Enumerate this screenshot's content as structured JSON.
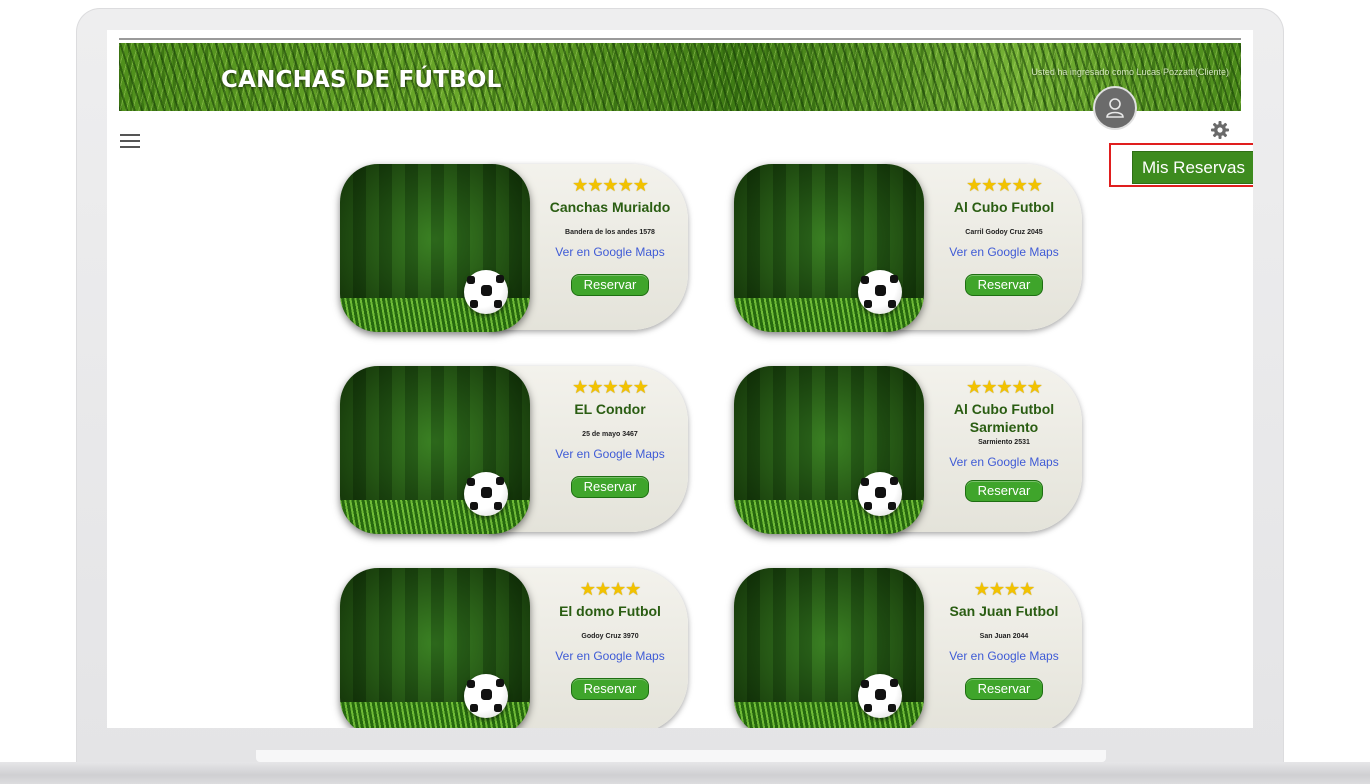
{
  "site": {
    "title": "CANCHAS DE FÚTBOL",
    "user_text": "Usted ha ingresado como Lucas Pozzatti(Cliente)"
  },
  "toolbar": {
    "mis_reservas_label": "Mis Reservas"
  },
  "link_label": "Ver en Google Maps",
  "reserve_label": "Reservar",
  "cards": [
    {
      "name": "Canchas Murialdo",
      "address": "Bandera de los andes 1578",
      "stars": "★★★★★"
    },
    {
      "name": "Al Cubo Futbol",
      "address": "Carril Godoy Cruz 2045",
      "stars": "★★★★★"
    },
    {
      "name": "EL Condor",
      "address": "25 de mayo 3467",
      "stars": "★★★★★"
    },
    {
      "name": "Al Cubo Futbol Sarmiento",
      "address": "Sarmiento 2531",
      "stars": "★★★★★"
    },
    {
      "name": "El domo Futbol",
      "address": "Godoy Cruz 3970",
      "stars": "★★★★"
    },
    {
      "name": "San Juan Futbol",
      "address": "San Juan 2044",
      "stars": "★★★★"
    }
  ],
  "colors": {
    "brand_green": "#3d8b1e",
    "highlight_red": "#e01e1e",
    "link_blue": "#3f5bd6"
  }
}
